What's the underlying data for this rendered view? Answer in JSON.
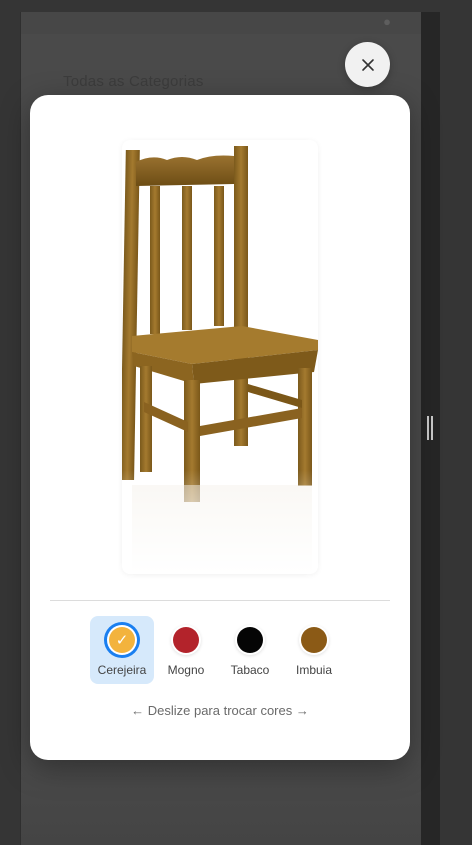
{
  "background_page": {
    "heading": "Todas as Categorias",
    "top_icon": "bell-icon"
  },
  "modal": {
    "close_icon": "close-icon",
    "product_image_alt": "wooden-chair-image",
    "color_options": [
      {
        "label": "Cerejeira",
        "color": "#f3b33d",
        "selected": true
      },
      {
        "label": "Mogno",
        "color": "#b3232b",
        "selected": false
      },
      {
        "label": "Tabaco",
        "color": "#050505",
        "selected": false
      },
      {
        "label": "Imbuia",
        "color": "#8b5a16",
        "selected": false
      }
    ],
    "hint_text": "← Deslize para trocar cores →"
  },
  "colors": {
    "accent": "#1a7ff0",
    "selected_bg": "#d6e9fb"
  }
}
